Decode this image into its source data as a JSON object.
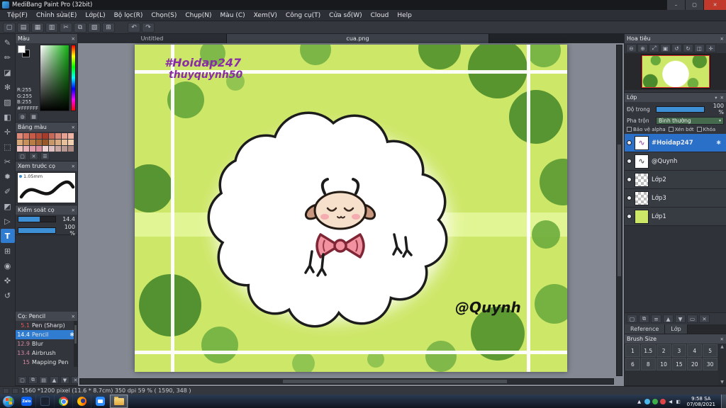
{
  "window": {
    "title": "MediBang Paint Pro (32bit)",
    "min": "–",
    "max": "▢",
    "close": "✕"
  },
  "ui": {
    "close": "✕",
    "caret": "▾",
    "gear": "✱",
    "up": "▲",
    "down": "▼"
  },
  "menu": {
    "items": [
      "Tệp(F)",
      "Chỉnh sửa(E)",
      "Lớp(L)",
      "Bộ lọc(R)",
      "Chọn(S)",
      "Chụp(N)",
      "Màu (C)",
      "Xem(V)",
      "Công cụ(T)",
      "Cửa sổ(W)",
      "Cloud",
      "Help"
    ]
  },
  "toolbar": {
    "file_icons": [
      {
        "name": "new-file-button",
        "glyph": "▢"
      },
      {
        "name": "open-file-button",
        "glyph": "▤"
      },
      {
        "name": "save-button",
        "glyph": "▦"
      },
      {
        "name": "export-button",
        "glyph": "▥"
      },
      {
        "name": "cut-button",
        "glyph": "✂"
      },
      {
        "name": "copy-button",
        "glyph": "⧉"
      },
      {
        "name": "paste-button",
        "glyph": "▧"
      },
      {
        "name": "grid-button",
        "glyph": "⊞"
      }
    ],
    "history_icons": [
      {
        "name": "undo-button",
        "glyph": "↶"
      },
      {
        "name": "redo-button",
        "glyph": "↷"
      }
    ]
  },
  "tools": {
    "items": [
      {
        "name": "pen-tool",
        "glyph": "✎"
      },
      {
        "name": "pencil-tool",
        "glyph": "✏"
      },
      {
        "name": "eraser-tool",
        "glyph": "◪"
      },
      {
        "name": "airbrush-tool",
        "glyph": "✻"
      },
      {
        "name": "fill-tool",
        "glyph": "▨"
      },
      {
        "name": "gradient-tool",
        "glyph": "◧"
      },
      {
        "name": "move-tool",
        "glyph": "✛"
      },
      {
        "name": "select-tool",
        "glyph": "⬚"
      },
      {
        "name": "lasso-tool",
        "glyph": "✂"
      },
      {
        "name": "magic-wand-tool",
        "glyph": "✹"
      },
      {
        "name": "select-pen-tool",
        "glyph": "✐"
      },
      {
        "name": "select-eraser-tool",
        "glyph": "◩"
      },
      {
        "name": "operation-tool",
        "glyph": "▷"
      },
      {
        "name": "text-tool",
        "glyph": "T",
        "selected": true
      },
      {
        "name": "divide-tool",
        "glyph": "⊞"
      },
      {
        "name": "eyedropper-tool",
        "glyph": "◉"
      },
      {
        "name": "hand-tool",
        "glyph": "✜"
      },
      {
        "name": "rotate-tool",
        "glyph": "↺"
      }
    ]
  },
  "panels": {
    "color": {
      "title": "Màu",
      "r": "R:255",
      "g": "G:255",
      "b": "B:255",
      "hex": "#FFFFFF"
    },
    "palette": {
      "title": "Bảng màu",
      "colors": [
        "#e08a7a",
        "#d4705e",
        "#c85a48",
        "#b84a38",
        "#a83c2c",
        "#c86858",
        "#d88878",
        "#e8a090",
        "#f0b4a4",
        "#d8a878",
        "#c89058",
        "#b87c44",
        "#a86834",
        "#985828",
        "#c89868",
        "#d8ac80",
        "#e8c098",
        "#f0d0b0",
        "#f0c4c0",
        "#e8b0b4",
        "#e09ca8",
        "#d88c9c",
        "#f0d4d4",
        "#e0c0c0",
        "#c8a8a0",
        "#b89890",
        "#a88880"
      ],
      "footer_icons": [
        {
          "name": "add-color-button",
          "glyph": "▢"
        },
        {
          "name": "delete-color-button",
          "glyph": "✕"
        },
        {
          "name": "palette-menu-button",
          "glyph": "☰"
        }
      ]
    },
    "preview": {
      "title": "Xem trước cọ",
      "size_label": "1.05mm"
    },
    "ctrl": {
      "title": "Kiểm soát cọ",
      "size_value": "14.4",
      "opacity_value": "100 %"
    },
    "brushes": {
      "title": "Cọ: Pencil",
      "items": [
        {
          "size": "5.1",
          "name": "Pen (Sharp)"
        },
        {
          "size": "14.4",
          "name": "Pencil",
          "selected": true
        },
        {
          "size": "12.9",
          "name": "Blur"
        },
        {
          "size": "13.4",
          "name": "Airbrush"
        },
        {
          "size": "15",
          "name": "Mapping Pen"
        }
      ],
      "footer_icons": [
        {
          "name": "add-brush-button",
          "glyph": "▢"
        },
        {
          "name": "duplicate-brush-button",
          "glyph": "⧉"
        },
        {
          "name": "brush-folder-button",
          "glyph": "▤"
        },
        {
          "name": "brush-up-button",
          "glyph": "▲"
        },
        {
          "name": "brush-down-button",
          "glyph": "▼"
        },
        {
          "name": "delete-brush-button",
          "glyph": "✕"
        }
      ]
    }
  },
  "doc_tabs": [
    "Untitled",
    "cua.png"
  ],
  "canvas": {
    "hashtag": "#Hoidap247",
    "username": "thuyquynh50",
    "signature": "@Quynh"
  },
  "navigator": {
    "title": "Hoa tiêu",
    "zoom_icons": [
      {
        "name": "zoom-out-icon",
        "glyph": "⊖"
      },
      {
        "name": "zoom-in-icon",
        "glyph": "⊕"
      },
      {
        "name": "zoom-fit-icon",
        "glyph": "⤢"
      },
      {
        "name": "zoom-100-icon",
        "glyph": "▣"
      },
      {
        "name": "rotate-left-icon",
        "glyph": "↺"
      },
      {
        "name": "rotate-right-icon",
        "glyph": "↻"
      },
      {
        "name": "flip-icon",
        "glyph": "◫"
      },
      {
        "name": "reset-view-icon",
        "glyph": "✛"
      }
    ]
  },
  "layers": {
    "title": "Lớp",
    "opacity_label": "Độ trong",
    "opacity_value": "100 %",
    "blend_label": "Pha trộn",
    "blend_value": "Bình thường",
    "checks": [
      "Bảo vệ alpha",
      "Xén bớt",
      "Khóa"
    ],
    "items": [
      {
        "name": "#Hoidap247",
        "thumb_glyph": "∿",
        "selected": true
      },
      {
        "name": "@Quynh",
        "thumb_glyph": "∿"
      },
      {
        "name": "Lớp2"
      },
      {
        "name": "Lớp3"
      },
      {
        "name": "Lớp1"
      }
    ],
    "footer_icons": [
      {
        "name": "add-layer-button",
        "glyph": "▢"
      },
      {
        "name": "duplicate-layer-button",
        "glyph": "⧉"
      },
      {
        "name": "merge-layer-button",
        "glyph": "≡"
      },
      {
        "name": "layer-up-button",
        "glyph": "▲"
      },
      {
        "name": "layer-down-button",
        "glyph": "▼"
      },
      {
        "name": "clear-layer-button",
        "glyph": "▭"
      },
      {
        "name": "delete-layer-button",
        "glyph": "✕"
      }
    ],
    "footer_tabs": [
      "Reference",
      "Lớp"
    ]
  },
  "bsize": {
    "title": "Brush Size",
    "cells": [
      "1",
      "1.5",
      "2",
      "3",
      "4",
      "5",
      "6",
      "8",
      "10",
      "15",
      "20",
      "30"
    ]
  },
  "status_bar": {
    "text": "1560 *1200 pixel  (11.6 * 8.7cm)  350 dpi  59 %  ( 1590, 348 )"
  },
  "taskbar": {
    "zalo_label": "Zalo",
    "time": "9:58 SA",
    "date": "07/08/2021",
    "tray_icons": [
      {
        "name": "show-hidden-icons-button",
        "glyph": "▲"
      },
      {
        "name": "tray-app-teal-icon",
        "color": "#4ab8e8"
      },
      {
        "name": "tray-app-green-icon",
        "color": "#3fae4a"
      },
      {
        "name": "tray-app-red-icon",
        "color": "#e04545"
      },
      {
        "name": "tray-volume-icon",
        "glyph": "◀"
      },
      {
        "name": "tray-network-icon",
        "glyph": "◧"
      }
    ]
  }
}
